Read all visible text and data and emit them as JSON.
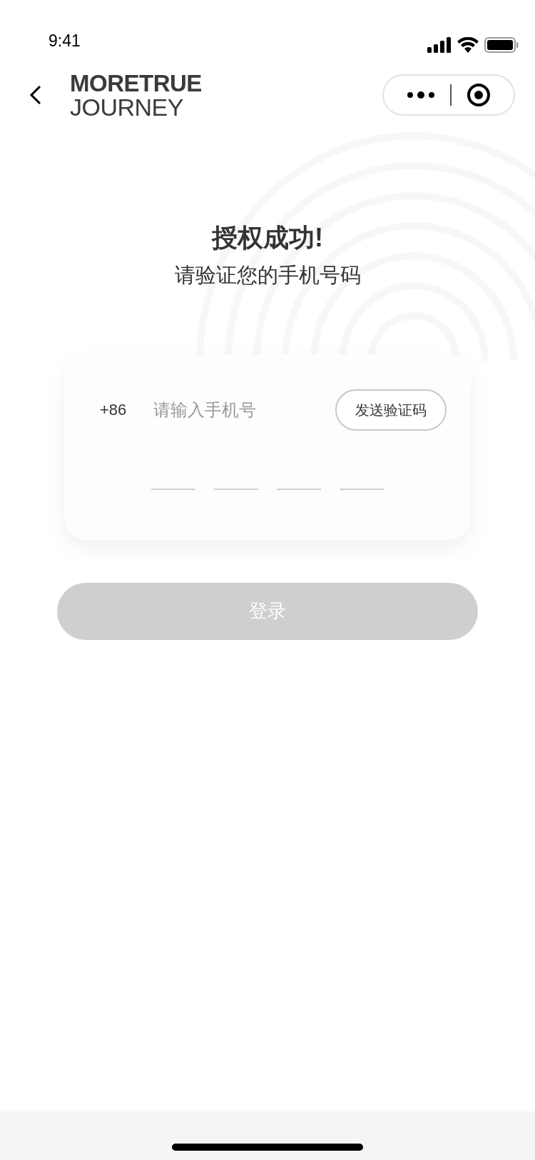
{
  "status_bar": {
    "time": "9:41"
  },
  "nav": {
    "logo_top": "MORETRUE",
    "logo_bottom": "JOURNEY"
  },
  "heading": {
    "title": "授权成功!",
    "subtitle": "请验证您的手机号码"
  },
  "form": {
    "country_code": "+86",
    "phone": {
      "placeholder": "请输入手机号"
    },
    "send_code": "发送验证码",
    "code_slots": [
      {
        "filled": false
      },
      {
        "filled": false
      },
      {
        "filled": false
      },
      {
        "filled": false
      }
    ]
  },
  "login": {
    "label": "登录",
    "disabled": true
  }
}
